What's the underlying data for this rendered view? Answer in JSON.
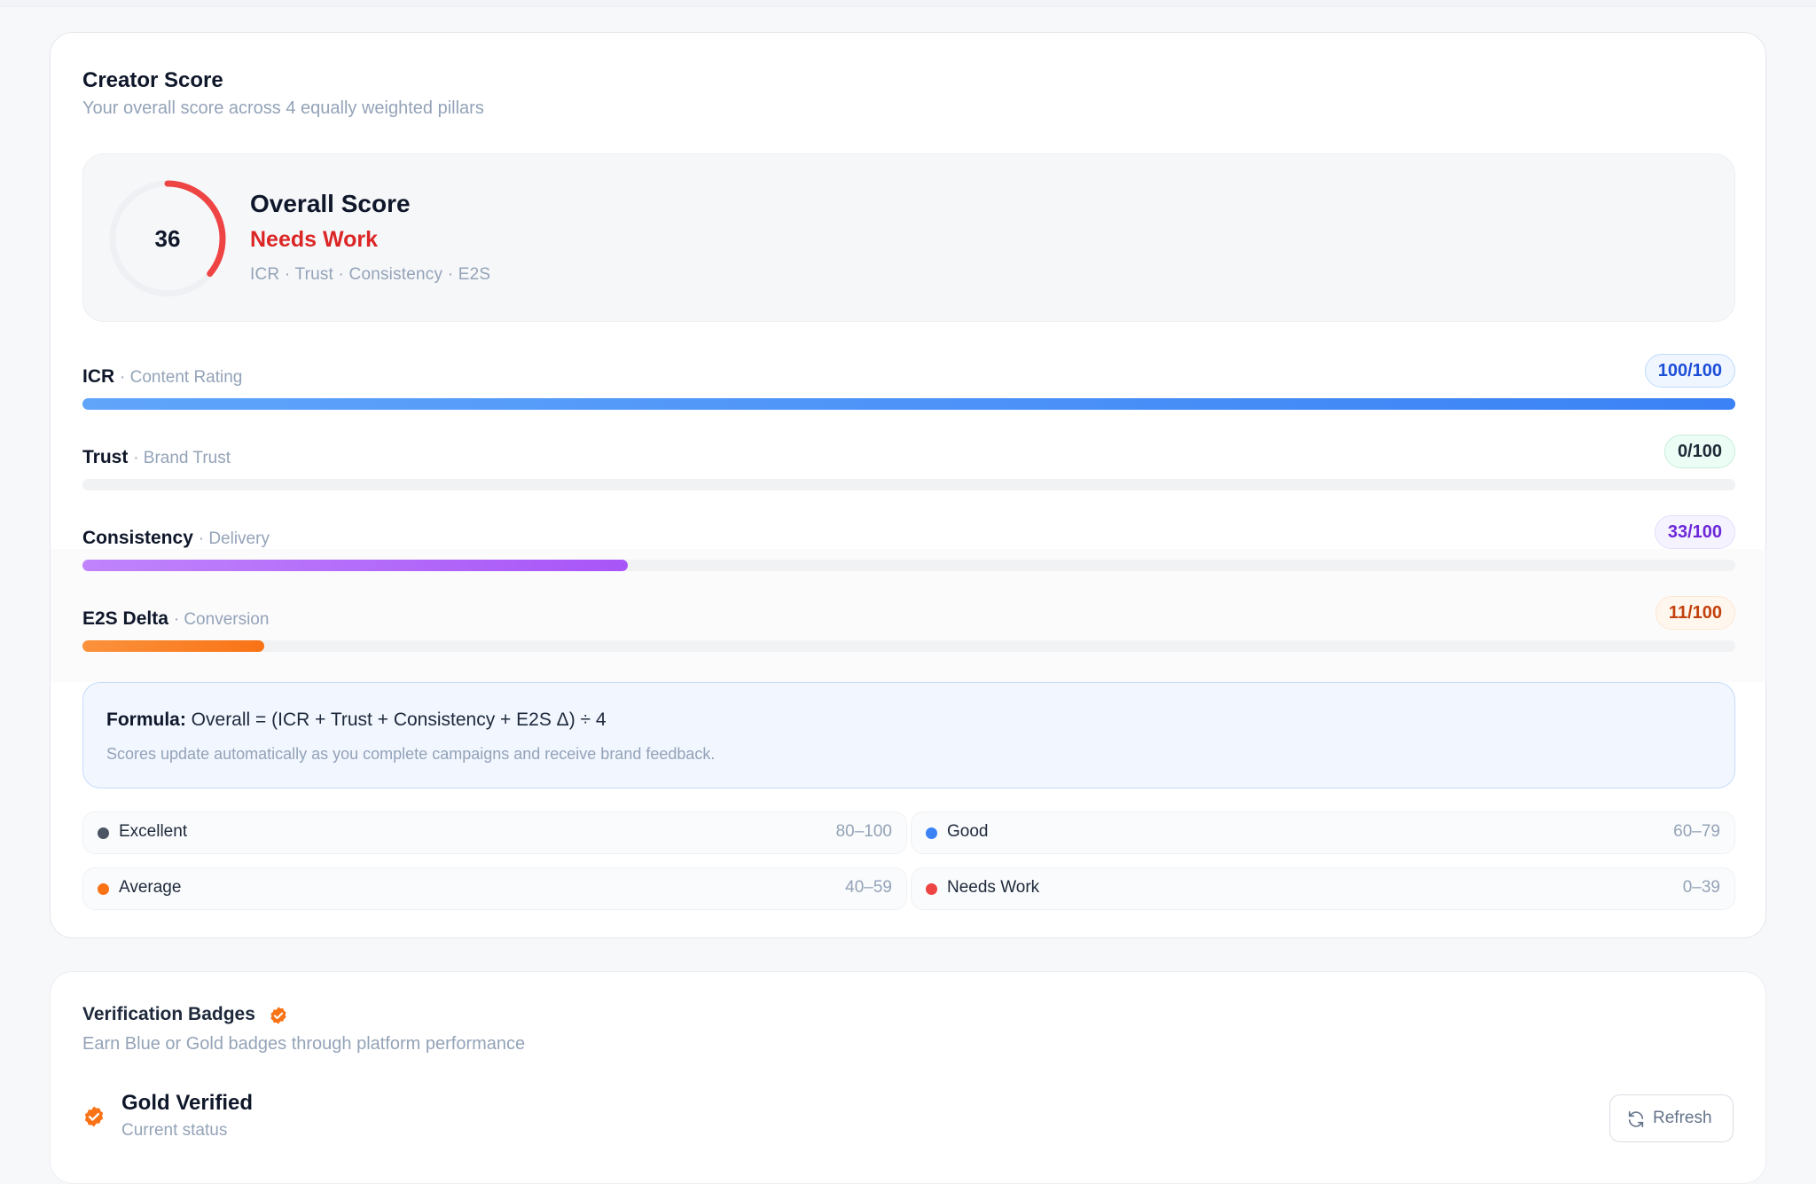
{
  "creator_score": {
    "title": "Creator Score",
    "subtitle": "Your overall score across 4 equally weighted pillars",
    "overall": {
      "score": "36",
      "score_value": 36,
      "title": "Overall Score",
      "status": "Needs Work",
      "pillars_line": "ICR · Trust · Consistency · E2S",
      "ring_color": "#ef4444"
    },
    "pillars": [
      {
        "name": "ICR",
        "desc": "· Content Rating",
        "badge": "100/100",
        "value": 100,
        "color": "#3b82f6"
      },
      {
        "name": "Trust",
        "desc": "· Brand Trust",
        "badge": "0/100",
        "value": 0,
        "color": "#10b981"
      },
      {
        "name": "Consistency",
        "desc": "· Delivery",
        "badge": "33/100",
        "value": 33,
        "color": "#a855f7"
      },
      {
        "name": "E2S Delta",
        "desc": "· Conversion",
        "badge": "11/100",
        "value": 11,
        "color": "#f97316"
      }
    ],
    "formula": {
      "label": "Formula:",
      "text": " Overall = (ICR + Trust + Consistency + E2S Δ) ÷ 4",
      "note": "Scores update automatically as you complete campaigns and receive brand feedback."
    },
    "legend": [
      {
        "label": "Excellent",
        "range": "80–100",
        "color": "#4b5563"
      },
      {
        "label": "Good",
        "range": "60–79",
        "color": "#3b82f6"
      },
      {
        "label": "Average",
        "range": "40–59",
        "color": "#f97316"
      },
      {
        "label": "Needs Work",
        "range": "0–39",
        "color": "#ef4444"
      }
    ]
  },
  "verification": {
    "title": "Verification Badges",
    "subtitle": "Earn Blue or Gold badges through platform performance",
    "status_title": "Gold Verified",
    "status_sub": "Current status",
    "refresh_label": "Refresh",
    "badge_color": "#f97316"
  }
}
